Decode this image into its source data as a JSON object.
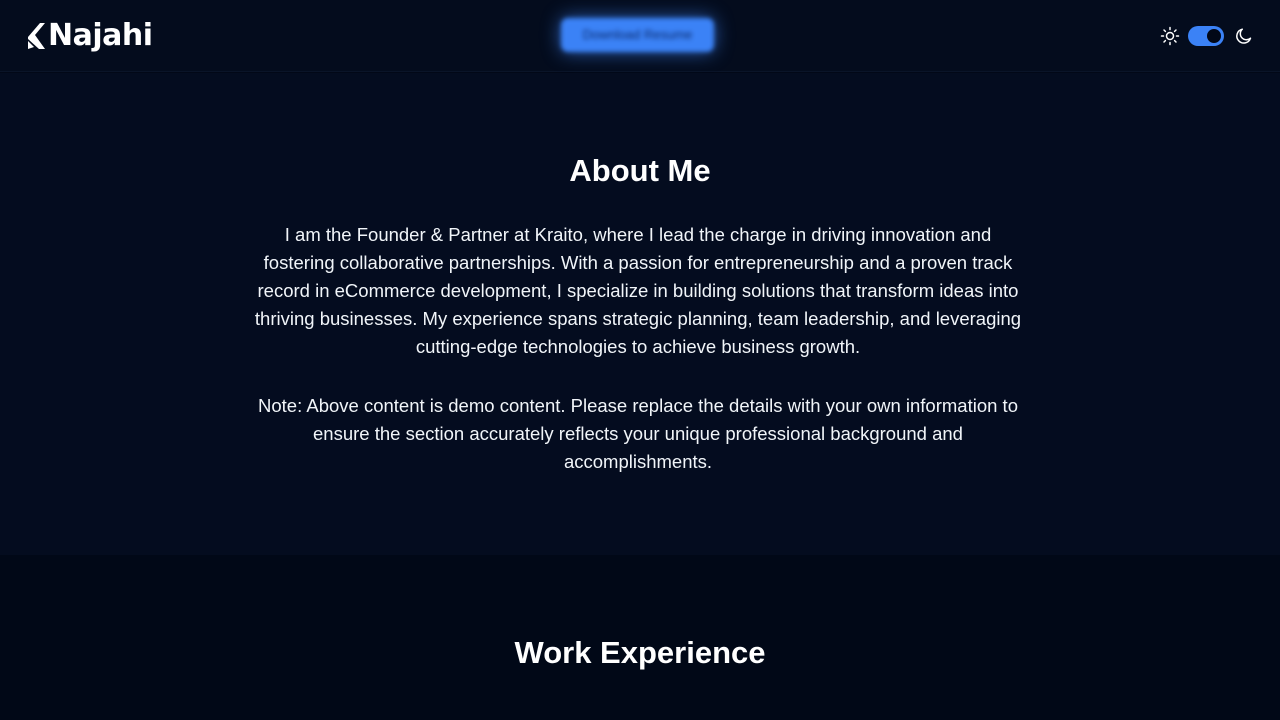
{
  "header": {
    "logo_text": "Najahi",
    "download_label": "Download Resume",
    "theme": {
      "light_icon": "sun-icon",
      "dark_icon": "moon-icon",
      "mode": "dark",
      "accent": "#3b82f6"
    }
  },
  "about": {
    "title": "About Me",
    "paragraph": "I am the Founder & Partner at Kraito, where I lead the charge in driving innovation and fostering collaborative partnerships. With a passion for entrepreneurship and a proven track record in eCommerce development, I specialize in building solutions that transform ideas into thriving businesses. My experience spans strategic planning, team leadership, and leveraging cutting-edge technologies to achieve business growth.",
    "note": "Note: Above content is demo content. Please replace the details with your own information to ensure the section accurately reflects your unique professional background and accomplishments."
  },
  "work": {
    "title": "Work Experience"
  },
  "colors": {
    "background": "#020817",
    "header_bg": "#040c1d",
    "about_bg": "#040c1f",
    "accent": "#3b82f6",
    "text": "#f1f5f9"
  }
}
